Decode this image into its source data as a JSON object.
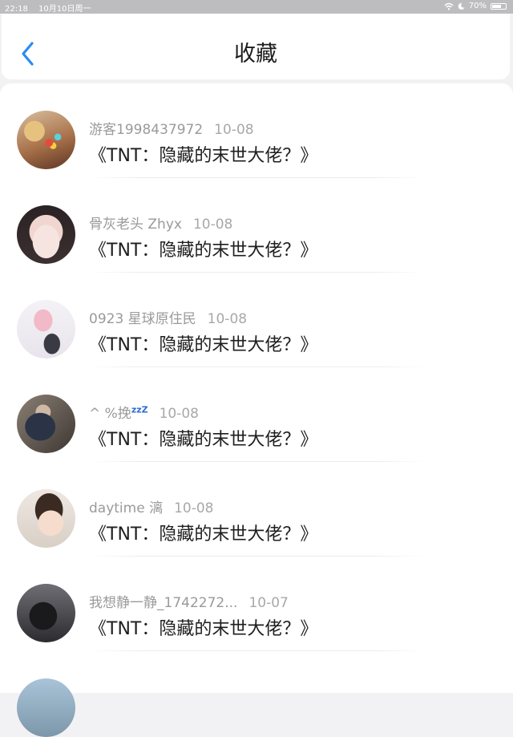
{
  "status_bar": {
    "time": "22:18",
    "date": "10月10日周一",
    "battery": "70%",
    "battery_level": 0.7
  },
  "header": {
    "title": "收藏",
    "back_icon": "chevron-left-icon",
    "accent_color": "#2a8cf0"
  },
  "favorites": [
    {
      "user": "游客1998437972",
      "date": "10-08",
      "title": "《TNT：隐藏的末世大佬？》"
    },
    {
      "user": "骨灰老头 Zhyx",
      "date": "10-08",
      "title": "《TNT：隐藏的末世大佬？》"
    },
    {
      "user": "0923 星球原住民",
      "date": "10-08",
      "title": "《TNT：隐藏的末世大佬？》"
    },
    {
      "user": "^ %挽",
      "user_suffix": "zzZ",
      "date": "10-08",
      "title": "《TNT：隐藏的末世大佬？》"
    },
    {
      "user": "daytime 漓",
      "date": "10-08",
      "title": "《TNT：隐藏的末世大佬？》"
    },
    {
      "user": "我想静一静_1742272...",
      "date": "10-07",
      "title": "《TNT：隐藏的末世大佬？》"
    }
  ]
}
